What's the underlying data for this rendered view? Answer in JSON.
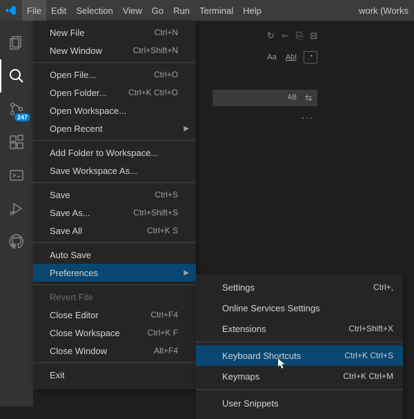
{
  "titlebar": {
    "title": "work (Works"
  },
  "menubar": {
    "file": "File",
    "edit": "Edit",
    "selection": "Selection",
    "view": "View",
    "go": "Go",
    "run": "Run",
    "terminal": "Terminal",
    "help": "Help"
  },
  "activitybar": {
    "badge": "247"
  },
  "find": {
    "aa": "Aa",
    "ab": "Ab|",
    "dot": ".*",
    "letters": "AB"
  },
  "file_menu": {
    "new_file": "New File",
    "new_file_sc": "Ctrl+N",
    "new_window": "New Window",
    "new_window_sc": "Ctrl+Shift+N",
    "open_file": "Open File...",
    "open_file_sc": "Ctrl+O",
    "open_folder": "Open Folder...",
    "open_folder_sc": "Ctrl+K Ctrl+O",
    "open_workspace": "Open Workspace...",
    "open_recent": "Open Recent",
    "add_folder": "Add Folder to Workspace...",
    "save_ws_as": "Save Workspace As...",
    "save": "Save",
    "save_sc": "Ctrl+S",
    "save_as": "Save As...",
    "save_as_sc": "Ctrl+Shift+S",
    "save_all": "Save All",
    "save_all_sc": "Ctrl+K S",
    "auto_save": "Auto Save",
    "preferences": "Preferences",
    "revert": "Revert File",
    "close_editor": "Close Editor",
    "close_editor_sc": "Ctrl+F4",
    "close_ws": "Close Workspace",
    "close_ws_sc": "Ctrl+K F",
    "close_window": "Close Window",
    "close_window_sc": "Alt+F4",
    "exit": "Exit"
  },
  "pref_menu": {
    "settings": "Settings",
    "settings_sc": "Ctrl+,",
    "online": "Online Services Settings",
    "extensions": "Extensions",
    "extensions_sc": "Ctrl+Shift+X",
    "kbd": "Keyboard Shortcuts",
    "kbd_sc": "Ctrl+K Ctrl+S",
    "keymaps": "Keymaps",
    "keymaps_sc": "Ctrl+K Ctrl+M",
    "snippets": "User Snippets"
  }
}
